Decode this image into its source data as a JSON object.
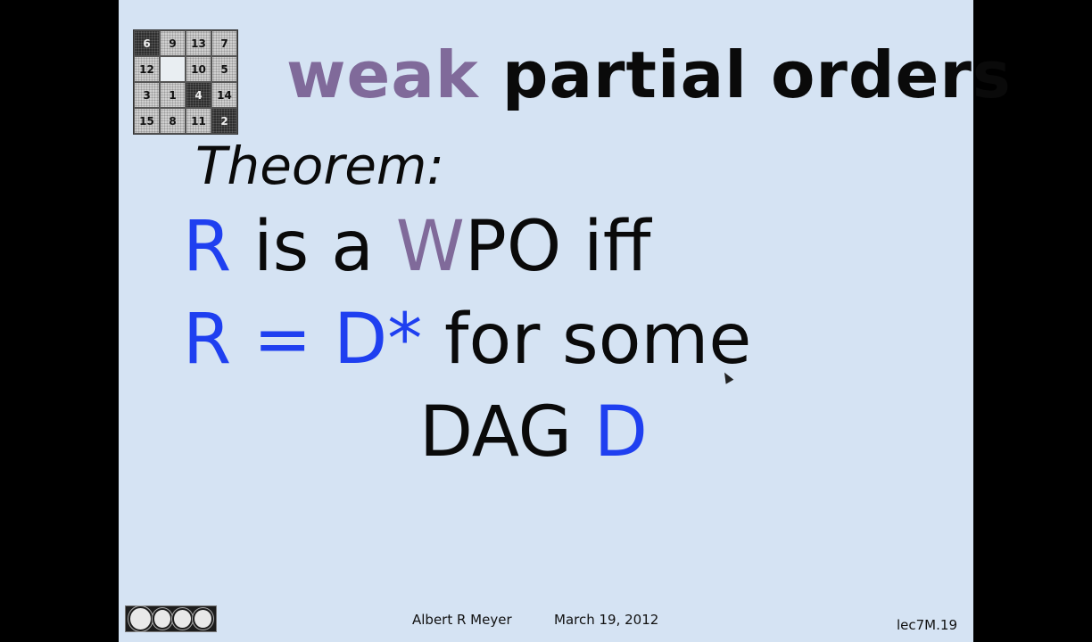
{
  "slide": {
    "title_weak": "weak",
    "title_rest": "partial orders",
    "theorem_label": "Theorem:",
    "line1": {
      "r": "R",
      "is_a": "is a",
      "w": "W",
      "po_iff": "PO iff"
    },
    "line2": {
      "r": "R",
      "eq": "=",
      "dstar": "D*",
      "for_some": "for some"
    },
    "line3": {
      "dag": "DAG",
      "d": "D"
    },
    "colors": {
      "background": "#d5e3f3",
      "blue": "#1f3ff0",
      "purple": "#806a9a",
      "text": "#0a0a0a"
    }
  },
  "puzzle": {
    "tiles": [
      "6",
      "9",
      "13",
      "7",
      "12",
      "",
      "10",
      "5",
      "3",
      "1",
      "4",
      "14",
      "15",
      "8",
      "11",
      "2"
    ]
  },
  "footer": {
    "author": "Albert R Meyer",
    "date": "March 19, 2012",
    "slide_id": "lec7M.19",
    "license_icon": "creative-commons-by-nc-sa-icon"
  }
}
